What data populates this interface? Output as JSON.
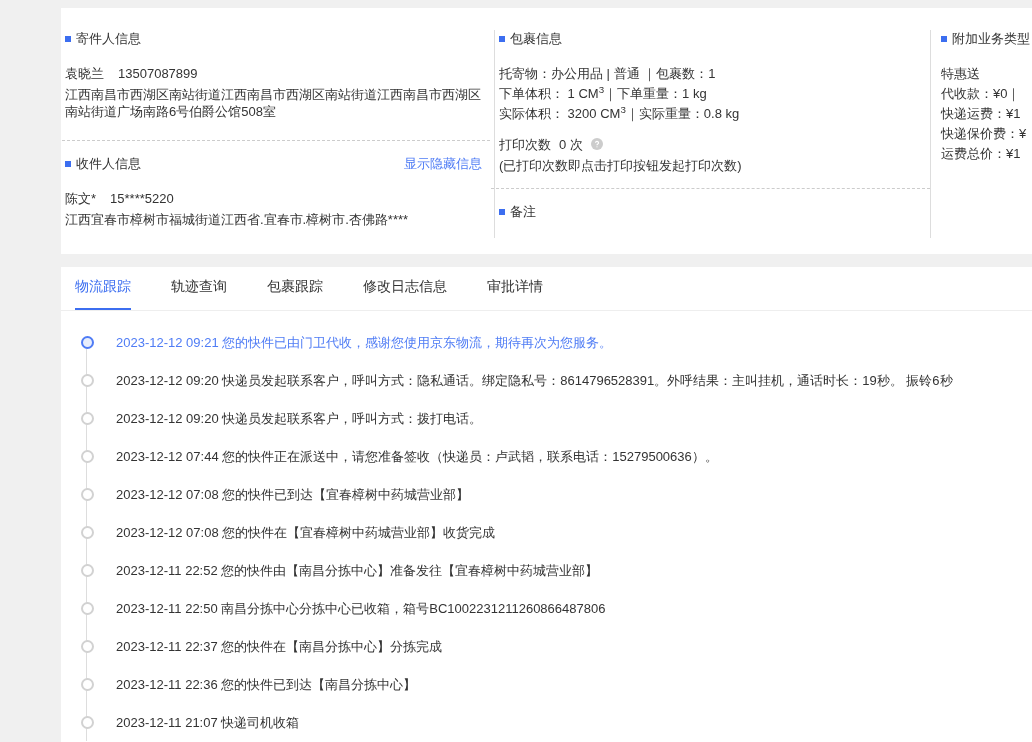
{
  "sender": {
    "title": "寄件人信息",
    "name": "袁晓兰",
    "phone": "13507087899",
    "address": "江西南昌市西湖区南站街道江西南昌市西湖区南站街道江西南昌市西湖区南站街道广场南路6号伯爵公馆508室"
  },
  "receiver": {
    "title": "收件人信息",
    "link": "显示隐藏信息",
    "name": "陈文*",
    "phone": "15****5220",
    "address": "江西宜春市樟树市福城街道江西省.宜春市.樟树市.杏佛路****"
  },
  "package": {
    "title": "包裹信息",
    "lines": [
      "托寄物：办公用品 | 普通 ｜包裹数：1",
      "下单体积：  1 CM$^{3}$｜下单重量：1 kg",
      "实际体积：  3200 CM$^{3}$｜实际重量：0.8 kg"
    ],
    "print_label": "打印次数",
    "print_count": "0 次",
    "print_note": "(已打印次数即点击打印按钮发起打印次数)"
  },
  "remark": {
    "title": "备注"
  },
  "extra": {
    "title": "附加业务类型",
    "lines": [
      "特惠送",
      "代收款：¥0｜",
      "快递运费：¥1",
      "快递保价费：¥",
      "运费总价：¥1"
    ]
  },
  "tabs": [
    {
      "label": "物流跟踪",
      "selected": true
    },
    {
      "label": "轨迹查询",
      "selected": false
    },
    {
      "label": "包裹跟踪",
      "selected": false
    },
    {
      "label": "修改日志信息",
      "selected": false
    },
    {
      "label": "审批详情",
      "selected": false
    }
  ],
  "timeline": [
    {
      "time": "2023-12-12 09:21",
      "text": "您的快件已由门卫代收，感谢您使用京东物流，期待再次为您服务。",
      "current": true
    },
    {
      "time": "2023-12-12 09:20",
      "text": "快递员发起联系客户，呼叫方式：隐私通话。绑定隐私号：8614796528391。外呼结果：主叫挂机，通话时长：19秒。 振铃6秒",
      "current": false
    },
    {
      "time": "2023-12-12 09:20",
      "text": "快递员发起联系客户，呼叫方式：拨打电话。",
      "current": false
    },
    {
      "time": "2023-12-12 07:44",
      "text": "您的快件正在派送中，请您准备签收（快递员：卢武韬，联系电话：15279500636）。",
      "current": false
    },
    {
      "time": "2023-12-12 07:08",
      "text": "您的快件已到达【宜春樟树中药城营业部】",
      "current": false
    },
    {
      "time": "2023-12-12 07:08",
      "text": "您的快件在【宜春樟树中药城营业部】收货完成",
      "current": false
    },
    {
      "time": "2023-12-11 22:52",
      "text": "您的快件由【南昌分拣中心】准备发往【宜春樟树中药城营业部】",
      "current": false
    },
    {
      "time": "2023-12-11 22:50",
      "text": "南昌分拣中心分拣中心已收箱，箱号BC1002231211260866487806",
      "current": false
    },
    {
      "time": "2023-12-11 22:37",
      "text": "您的快件在【南昌分拣中心】分拣完成",
      "current": false
    },
    {
      "time": "2023-12-11 22:36",
      "text": "您的快件已到达【南昌分拣中心】",
      "current": false
    },
    {
      "time": "2023-12-11 21:07",
      "text": "快递司机收箱",
      "current": false
    }
  ]
}
